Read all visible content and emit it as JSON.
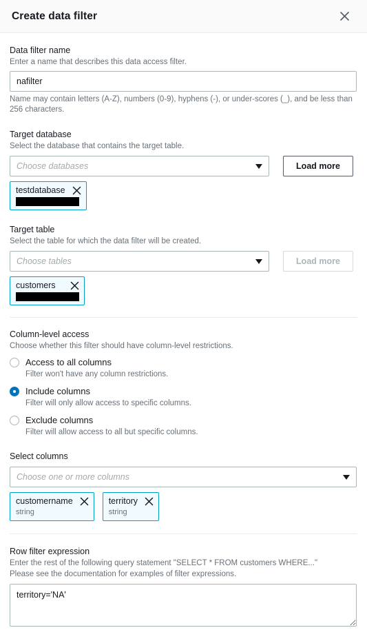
{
  "modal": {
    "title": "Create data filter",
    "close_icon": "close-icon"
  },
  "filter_name": {
    "label": "Data filter name",
    "description": "Enter a name that describes this data access filter.",
    "value": "nafilter",
    "placeholder": "",
    "help": "Name may contain letters (A-Z), numbers (0-9), hyphens (-), or under-scores (_), and be less than 256 characters."
  },
  "target_database": {
    "label": "Target database",
    "description": "Select the database that contains the target table.",
    "placeholder": "Choose databases",
    "load_more_label": "Load more",
    "load_more_disabled": false,
    "chips": [
      {
        "label": "testdatabase",
        "redacted": true,
        "remove_icon": "close-icon"
      }
    ]
  },
  "target_table": {
    "label": "Target table",
    "description": "Select the table for which the data filter will be created.",
    "placeholder": "Choose tables",
    "load_more_label": "Load more",
    "load_more_disabled": true,
    "chips": [
      {
        "label": "customers",
        "redacted": true,
        "remove_icon": "close-icon"
      }
    ]
  },
  "column_access": {
    "label": "Column-level access",
    "description": "Choose whether this filter should have column-level restrictions.",
    "selected": "include",
    "accent_color": "#0073bb",
    "options": [
      {
        "id": "all",
        "label": "Access to all columns",
        "description": "Filter won't have any column restrictions.",
        "checked": false
      },
      {
        "id": "include",
        "label": "Include columns",
        "description": "Filter will only allow access to specific columns.",
        "checked": true
      },
      {
        "id": "exclude",
        "label": "Exclude columns",
        "description": "Filter will allow access to all but specific columns.",
        "checked": false
      }
    ]
  },
  "select_columns": {
    "label": "Select columns",
    "placeholder": "Choose one or more columns",
    "chips": [
      {
        "label": "customername",
        "type": "string",
        "remove_icon": "close-icon"
      },
      {
        "label": "territory",
        "type": "string",
        "remove_icon": "close-icon"
      }
    ]
  },
  "row_filter": {
    "label": "Row filter expression",
    "description_line1": "Enter the rest of the following query statement \"SELECT * FROM customers WHERE...\"",
    "description_line2": "Please see the documentation for examples of filter expressions.",
    "value": "territory='NA'",
    "placeholder": ""
  }
}
